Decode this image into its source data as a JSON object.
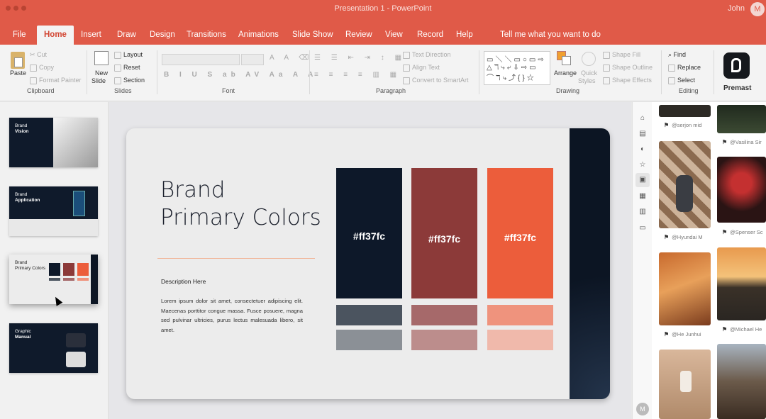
{
  "titlebar": {
    "title": "Presentation 1 - PowerPoint",
    "user": "John",
    "avatar_initial": "M"
  },
  "tabs": [
    "File",
    "Home",
    "Insert",
    "Draw",
    "Design",
    "Transitions",
    "Animations",
    "Slide Show",
    "Review",
    "View",
    "Record",
    "Help",
    "Tell me what you want to do"
  ],
  "ribbon": {
    "clipboard": {
      "paste": "Paste",
      "cut": "Cut",
      "copy": "Copy",
      "format_painter": "Format Painter",
      "label": "Clipboard"
    },
    "slides": {
      "new_slide": "New",
      "new_slide2": "Slide",
      "layout": "Layout",
      "reset": "Reset",
      "section": "Section",
      "label": "Slides"
    },
    "font": {
      "label": "Font"
    },
    "paragraph": {
      "text_direction": "Text Direction",
      "align_text": "Align Text",
      "smartart": "Convert to SmartArt",
      "label": "Paragraph"
    },
    "drawing": {
      "arrange": "Arrange",
      "quick_styles": "Quick",
      "quick_styles2": "Styles",
      "shape_fill": "Shape Fill",
      "shape_outline": "Shape Outline",
      "shape_effects": "Shape Effects",
      "label": "Drawing"
    },
    "editing": {
      "find": "Find",
      "replace": "Replace",
      "select": "Select",
      "label": "Editing"
    },
    "premast": {
      "label": "Premast"
    }
  },
  "thumbnails": [
    {
      "title_thin": "Brand",
      "title_bold": "Vision"
    },
    {
      "title_thin": "Brand",
      "title_bold": "Application"
    },
    {
      "title_thin": "Brand",
      "title_bold": "Primary Colors"
    },
    {
      "title_thin": "Graphic",
      "title_bold": "Manual"
    }
  ],
  "slide": {
    "title": "Brand\nPrimary Colors",
    "description_heading": "Description Here",
    "description_body": "Lorem ipsum dolor sit amet, consectetuer adipiscing elit. Maecenas porttitor congue massa. Fusce posuere, magna sed pulvinar ultricies, purus lectus malesuada libero, sit amet.",
    "swatches": [
      {
        "label": "#ff37fc",
        "color": "#0d1829",
        "tint1": "#4b545f",
        "tint2": "#8b9096"
      },
      {
        "label": "#ff37fc",
        "color": "#8c3a39",
        "tint1": "#a6696a",
        "tint2": "#bc8d8c"
      },
      {
        "label": "#ff37fc",
        "color": "#ec5d3b",
        "tint1": "#ef937d",
        "tint2": "#f0b9ab"
      }
    ]
  },
  "image_panel": {
    "credits": [
      "@serjon mid",
      "@Vasilina Sir",
      "@Hyundai M",
      "@Spenser Sc",
      "@He Junhui",
      "@Michael He"
    ]
  }
}
